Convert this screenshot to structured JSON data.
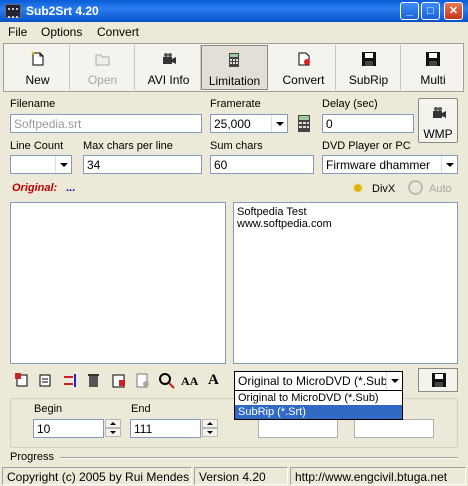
{
  "window": {
    "title": "Sub2Srt 4.20"
  },
  "menu": [
    "File",
    "Options",
    "Convert"
  ],
  "toolbar": [
    {
      "label": "New",
      "icon": "new-document-icon",
      "state": "normal"
    },
    {
      "label": "Open",
      "icon": "open-folder-icon",
      "state": "disabled"
    },
    {
      "label": "AVI Info",
      "icon": "video-camera-icon",
      "state": "normal"
    },
    {
      "label": "Limitation",
      "icon": "calculator-icon",
      "state": "pressed"
    },
    {
      "label": "Convert",
      "icon": "convert-document-icon",
      "state": "normal"
    },
    {
      "label": "SubRip",
      "icon": "floppy-disk-icon",
      "state": "normal"
    },
    {
      "label": "Multi",
      "icon": "floppy-disk-icon",
      "state": "normal"
    }
  ],
  "form": {
    "filename_label": "Filename",
    "filename_value": "Softpedia.srt",
    "framerate_label": "Framerate",
    "framerate_value": "25,000",
    "delay_label": "Delay (sec)",
    "delay_value": "0",
    "wmp_label": "WMP",
    "line_count_label": "Line Count",
    "line_count_value": "",
    "max_chars_label": "Max chars per line",
    "max_chars_value": "34",
    "sum_chars_label": "Sum chars",
    "sum_chars_value": "60",
    "player_label": "DVD Player or PC",
    "player_value": "Firmware dhammer"
  },
  "original": {
    "label": "Original:",
    "ellipsis": "...",
    "divx_label": "DivX",
    "auto_label": "Auto"
  },
  "panels": {
    "left_text": "",
    "right_lines": [
      "Softpedia Test",
      "www.softpedia.com"
    ]
  },
  "conversion": {
    "selected": "Original to MicroDVD (*.Sub)",
    "options": [
      "Original to MicroDVD (*.Sub)",
      "SubRip (*.Srt)"
    ],
    "highlighted_index": 1
  },
  "range": {
    "begin_label": "Begin",
    "begin_value": "10",
    "end_label": "End",
    "end_value": "111"
  },
  "progress": {
    "label": "Progress",
    "value": 0
  },
  "status": {
    "copyright": "Copyright (c) 2005 by Rui Mendes",
    "version": "Version 4.20",
    "url": "http://www.engcivil.btuga.net"
  },
  "colors": {
    "titlebar": "#0A5DD8",
    "original_label": "#C00000",
    "selection": "#316AC5"
  }
}
